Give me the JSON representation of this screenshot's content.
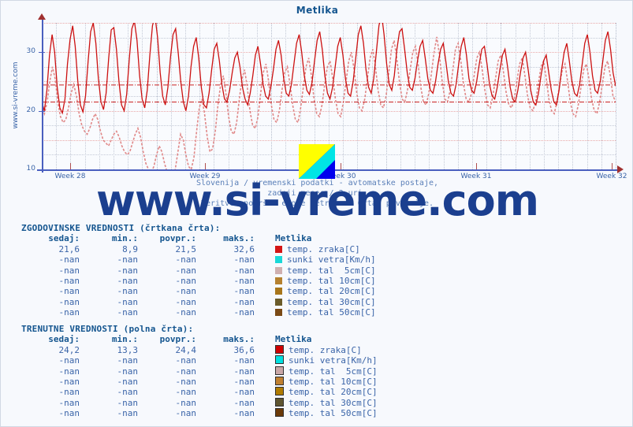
{
  "window": {
    "title": "Metlika"
  },
  "watermark": {
    "vertical": "www.si-vreme.com",
    "big": "www.si-vreme.com"
  },
  "caption": {
    "line1": "Slovenija / vremenski podatki - avtomatske postaje,",
    "line2": "zadnji mesec / 2 uri.",
    "line3": "Meritve: površne enote metrične. Črta: povprečje."
  },
  "chart_data": {
    "type": "line",
    "title": "Metlika",
    "xlabel": "",
    "ylabel": "",
    "ylim": [
      10,
      35
    ],
    "yticks": [
      10,
      20,
      30
    ],
    "xticks": [
      "Week 28",
      "Week 29",
      "Week 30",
      "Week 31",
      "Week 32"
    ],
    "grid": true,
    "legend": "none",
    "average_lines": [
      {
        "name": "trenutne povpr.",
        "value": 24.4,
        "color": "#cc2222"
      },
      {
        "name": "zgodovinske povpr.",
        "value": 21.5,
        "color": "#cc2222"
      }
    ],
    "series": [
      {
        "name": "temp. zraka[C] - trenutne (polna črta)",
        "style": "solid",
        "color": "#cc1111",
        "min": 13.3,
        "max": 36.6,
        "avg": 24.4,
        "now": 24.2,
        "values": [
          21.5,
          20.0,
          23.5,
          29.5,
          33.0,
          30.0,
          24.0,
          20.5,
          19.6,
          22.0,
          28.0,
          32.2,
          34.5,
          31.0,
          25.0,
          21.0,
          19.8,
          22.5,
          28.5,
          33.5,
          35.0,
          31.5,
          25.5,
          21.5,
          20.2,
          23.0,
          29.0,
          33.8,
          34.2,
          30.5,
          25.0,
          21.0,
          20.0,
          22.8,
          28.8,
          34.0,
          35.3,
          32.0,
          26.0,
          22.0,
          20.5,
          23.5,
          29.5,
          34.5,
          36.2,
          32.5,
          26.5,
          22.5,
          21.0,
          24.0,
          29.0,
          33.0,
          34.0,
          30.0,
          25.0,
          21.5,
          20.0,
          22.5,
          27.5,
          31.0,
          32.5,
          29.0,
          24.0,
          21.0,
          20.5,
          23.0,
          27.0,
          30.5,
          31.5,
          28.5,
          24.5,
          22.0,
          21.5,
          23.5,
          26.5,
          29.0,
          30.0,
          27.5,
          24.0,
          22.0,
          21.0,
          23.0,
          26.0,
          29.5,
          31.0,
          28.0,
          24.5,
          22.5,
          22.0,
          24.0,
          27.0,
          30.5,
          32.0,
          29.5,
          25.5,
          23.0,
          22.5,
          24.5,
          28.0,
          31.5,
          33.0,
          30.0,
          26.0,
          23.5,
          22.8,
          24.8,
          28.5,
          32.0,
          33.5,
          30.5,
          26.0,
          23.0,
          22.0,
          24.0,
          27.5,
          31.0,
          32.5,
          29.5,
          25.5,
          23.0,
          22.5,
          25.0,
          29.0,
          33.0,
          34.5,
          31.5,
          27.0,
          24.0,
          23.0,
          25.5,
          30.0,
          34.5,
          36.6,
          33.0,
          28.0,
          24.5,
          23.5,
          26.0,
          30.5,
          33.5,
          34.0,
          30.5,
          26.5,
          24.0,
          23.5,
          25.5,
          28.5,
          31.0,
          32.0,
          29.0,
          25.5,
          23.5,
          23.0,
          25.0,
          28.0,
          30.5,
          31.5,
          28.5,
          25.0,
          23.0,
          22.5,
          24.5,
          28.0,
          31.0,
          32.5,
          29.5,
          25.5,
          23.5,
          23.0,
          25.0,
          28.0,
          30.5,
          31.0,
          28.0,
          24.5,
          22.5,
          22.0,
          24.0,
          27.0,
          29.5,
          30.5,
          27.5,
          24.0,
          22.0,
          21.5,
          23.5,
          26.5,
          29.0,
          30.0,
          27.0,
          23.5,
          21.5,
          21.0,
          23.0,
          26.0,
          28.5,
          29.5,
          26.5,
          23.5,
          21.5,
          21.0,
          23.5,
          27.0,
          30.0,
          31.5,
          28.5,
          25.0,
          23.0,
          22.5,
          24.5,
          28.0,
          31.5,
          33.0,
          30.0,
          26.0,
          23.5,
          23.0,
          25.0,
          28.5,
          32.0,
          33.5,
          30.5,
          26.5,
          24.2
        ]
      },
      {
        "name": "temp. zraka[C] - zgodovinske (črtkana črta)",
        "style": "dashed",
        "color": "#e08888",
        "min": 8.9,
        "max": 32.6,
        "avg": 21.5,
        "now": 21.6,
        "values": [
          21.0,
          19.5,
          21.5,
          25.0,
          27.5,
          25.5,
          21.5,
          19.0,
          18.0,
          18.5,
          20.5,
          23.0,
          24.5,
          22.5,
          19.5,
          17.5,
          16.5,
          16.0,
          17.0,
          18.5,
          19.5,
          18.5,
          16.5,
          15.0,
          14.5,
          14.0,
          15.0,
          16.0,
          16.5,
          15.5,
          14.0,
          13.0,
          12.5,
          13.0,
          14.5,
          16.0,
          17.0,
          15.5,
          13.0,
          11.0,
          10.0,
          9.5,
          10.5,
          12.5,
          14.0,
          13.0,
          11.0,
          9.5,
          9.0,
          8.9,
          10.0,
          13.0,
          16.0,
          15.0,
          12.5,
          10.5,
          10.0,
          12.0,
          16.5,
          20.5,
          22.0,
          19.5,
          15.5,
          13.0,
          13.5,
          16.5,
          21.0,
          24.5,
          26.0,
          23.0,
          19.0,
          16.5,
          16.0,
          18.0,
          22.0,
          25.5,
          27.0,
          24.0,
          20.0,
          17.5,
          17.0,
          19.0,
          23.0,
          26.5,
          28.0,
          25.0,
          21.0,
          18.5,
          18.0,
          20.0,
          23.5,
          26.5,
          27.5,
          24.5,
          21.0,
          18.5,
          18.0,
          20.5,
          24.0,
          27.5,
          29.0,
          26.0,
          22.0,
          19.5,
          19.0,
          21.0,
          24.5,
          27.5,
          28.5,
          25.5,
          22.0,
          19.5,
          19.0,
          21.5,
          25.0,
          28.5,
          30.0,
          27.0,
          23.0,
          20.5,
          20.0,
          22.0,
          25.5,
          29.0,
          30.5,
          27.5,
          23.5,
          21.0,
          20.5,
          22.5,
          26.5,
          30.5,
          32.0,
          29.0,
          25.0,
          22.0,
          21.5,
          23.5,
          27.0,
          30.0,
          31.0,
          28.0,
          24.0,
          21.5,
          21.0,
          23.0,
          26.5,
          30.0,
          32.6,
          29.5,
          25.0,
          22.0,
          21.5,
          23.5,
          27.0,
          30.5,
          31.5,
          28.5,
          24.5,
          22.0,
          21.5,
          23.0,
          26.0,
          29.0,
          30.0,
          27.0,
          23.5,
          21.0,
          20.5,
          22.5,
          25.5,
          28.5,
          29.5,
          26.5,
          23.0,
          21.0,
          20.5,
          22.0,
          25.0,
          28.0,
          29.0,
          26.0,
          22.5,
          20.5,
          20.0,
          21.5,
          24.5,
          27.5,
          28.5,
          25.5,
          22.0,
          20.0,
          19.5,
          21.5,
          24.5,
          27.0,
          28.0,
          25.0,
          21.5,
          19.5,
          19.0,
          21.0,
          24.0,
          27.0,
          28.0,
          25.5,
          22.0,
          20.0,
          19.5,
          21.5,
          24.5,
          27.5,
          28.5,
          26.0,
          22.5,
          21.6
        ]
      }
    ]
  },
  "historic": {
    "heading": "ZGODOVINSKE VREDNOSTI (črtkana črta):",
    "columns": [
      "sedaj:",
      "min.:",
      "povpr.:",
      "maks.:",
      "Metlika"
    ],
    "rows": [
      {
        "now": "21,6",
        "min": "8,9",
        "avg": "21,5",
        "max": "32,6",
        "label": "temp. zraka[C]",
        "color": "#d41515"
      },
      {
        "now": "-nan",
        "min": "-nan",
        "avg": "-nan",
        "max": "-nan",
        "label": "sunki vetra[Km/h]",
        "color": "#19d8d8"
      },
      {
        "now": "-nan",
        "min": "-nan",
        "avg": "-nan",
        "max": "-nan",
        "label": "temp. tal  5cm[C]",
        "color": "#cfb0b0"
      },
      {
        "now": "-nan",
        "min": "-nan",
        "avg": "-nan",
        "max": "-nan",
        "label": "temp. tal 10cm[C]",
        "color": "#b5812f"
      },
      {
        "now": "-nan",
        "min": "-nan",
        "avg": "-nan",
        "max": "-nan",
        "label": "temp. tal 20cm[C]",
        "color": "#a8761a"
      },
      {
        "now": "-nan",
        "min": "-nan",
        "avg": "-nan",
        "max": "-nan",
        "label": "temp. tal 30cm[C]",
        "color": "#6b5c2a"
      },
      {
        "now": "-nan",
        "min": "-nan",
        "avg": "-nan",
        "max": "-nan",
        "label": "temp. tal 50cm[C]",
        "color": "#7a4a15"
      }
    ]
  },
  "current": {
    "heading": "TRENUTNE VREDNOSTI (polna črta):",
    "columns": [
      "sedaj:",
      "min.:",
      "povpr.:",
      "maks.:",
      "Metlika"
    ],
    "rows": [
      {
        "now": "24,2",
        "min": "13,3",
        "avg": "24,4",
        "max": "36,6",
        "label": "temp. zraka[C]",
        "color": "#d00000"
      },
      {
        "now": "-nan",
        "min": "-nan",
        "avg": "-nan",
        "max": "-nan",
        "label": "sunki vetra[Km/h]",
        "color": "#00e0e0"
      },
      {
        "now": "-nan",
        "min": "-nan",
        "avg": "-nan",
        "max": "-nan",
        "label": "temp. tal  5cm[C]",
        "color": "#c9a7a7"
      },
      {
        "now": "-nan",
        "min": "-nan",
        "avg": "-nan",
        "max": "-nan",
        "label": "temp. tal 10cm[C]",
        "color": "#c08030"
      },
      {
        "now": "-nan",
        "min": "-nan",
        "avg": "-nan",
        "max": "-nan",
        "label": "temp. tal 20cm[C]",
        "color": "#b07b00"
      },
      {
        "now": "-nan",
        "min": "-nan",
        "avg": "-nan",
        "max": "-nan",
        "label": "temp. tal 30cm[C]",
        "color": "#5f5530"
      },
      {
        "now": "-nan",
        "min": "-nan",
        "avg": "-nan",
        "max": "-nan",
        "label": "temp. tal 50cm[C]",
        "color": "#6b3a08"
      }
    ]
  }
}
